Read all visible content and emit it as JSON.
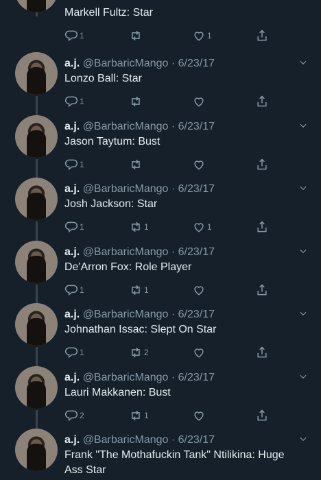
{
  "first": {
    "text": "Markell Fultz: Star",
    "replies": "1",
    "retweets": "",
    "likes": "1"
  },
  "tweets": [
    {
      "author": "a.j.",
      "handle": "@BarbaricMango",
      "date": "6/23/17",
      "text": "Lonzo Ball: Star",
      "replies": "1",
      "retweets": "",
      "likes": ""
    },
    {
      "author": "a.j.",
      "handle": "@BarbaricMango",
      "date": "6/23/17",
      "text": "Jason Taytum: Bust",
      "replies": "1",
      "retweets": "",
      "likes": ""
    },
    {
      "author": "a.j.",
      "handle": "@BarbaricMango",
      "date": "6/23/17",
      "text": "Josh Jackson: Star",
      "replies": "1",
      "retweets": "1",
      "likes": "1"
    },
    {
      "author": "a.j.",
      "handle": "@BarbaricMango",
      "date": "6/23/17",
      "text": "De'Arron Fox: Role Player",
      "replies": "1",
      "retweets": "1",
      "likes": ""
    },
    {
      "author": "a.j.",
      "handle": "@BarbaricMango",
      "date": "6/23/17",
      "text": "Johnathan Issac: Slept On Star",
      "replies": "1",
      "retweets": "2",
      "likes": ""
    },
    {
      "author": "a.j.",
      "handle": "@BarbaricMango",
      "date": "6/23/17",
      "text": "Lauri Makkanen: Bust",
      "replies": "2",
      "retweets": "1",
      "likes": ""
    },
    {
      "author": "a.j.",
      "handle": "@BarbaricMango",
      "date": "6/23/17",
      "text": "Frank \"The Mothafuckin Tank\" Ntilikina: Huge Ass Star",
      "replies": "",
      "retweets": "",
      "likes": ""
    }
  ],
  "separator": " · ",
  "icons": {
    "reply": "reply-icon",
    "retweet": "retweet-icon",
    "like": "heart-icon",
    "share": "share-icon",
    "menu": "chevron-down-icon"
  },
  "colors": {
    "background": "#15202b",
    "text": "#e6ecf0",
    "muted": "#8899a6",
    "thread_line": "#38444d"
  }
}
